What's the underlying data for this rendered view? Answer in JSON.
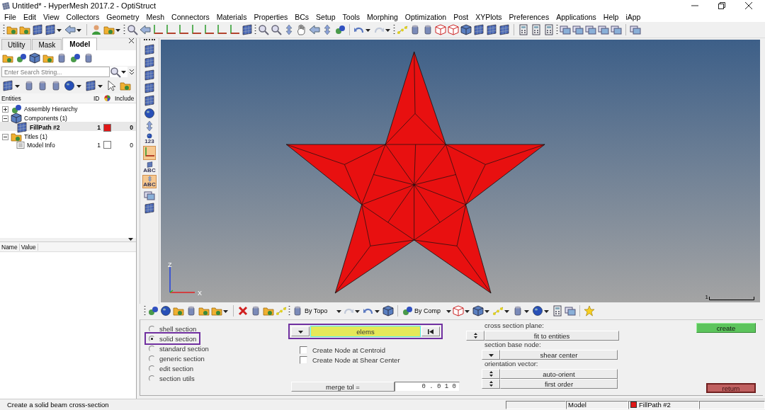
{
  "window": {
    "title": "Untitled* - HyperMesh 2017.2 - OptiStruct"
  },
  "menu": [
    "File",
    "Edit",
    "View",
    "Collectors",
    "Geometry",
    "Mesh",
    "Connectors",
    "Materials",
    "Properties",
    "BCs",
    "Setup",
    "Tools",
    "Morphing",
    "Optimization",
    "Post",
    "XYPlots",
    "Preferences",
    "Applications",
    "Help",
    "iApp"
  ],
  "browser": {
    "tabs": [
      {
        "label": "Utility",
        "selected": false
      },
      {
        "label": "Mask",
        "selected": false
      },
      {
        "label": "Model",
        "selected": true
      }
    ],
    "search": {
      "placeholder": "Enter Search String..."
    },
    "columns": [
      "Entities",
      "ID",
      "Include"
    ],
    "tree": [
      {
        "label": "Assembly Hierarchy",
        "kind": "assembly",
        "expanded": false
      },
      {
        "label": "Components (1)",
        "kind": "components",
        "expanded": true,
        "children": [
          {
            "label": "FillPath #2",
            "id": "1",
            "color": "#e01818",
            "include": "0",
            "selected": true
          }
        ]
      },
      {
        "label": "Titles (1)",
        "kind": "titles",
        "expanded": true,
        "children": [
          {
            "label": "Model Info",
            "id": "1",
            "include": "0",
            "selected": false
          }
        ]
      }
    ],
    "attribute_columns": [
      "Name",
      "Value"
    ]
  },
  "side_toolbar": {
    "labels": [
      "123",
      "ABC",
      "ABC"
    ]
  },
  "viewport": {
    "axes": {
      "z": "Z",
      "x": "X"
    },
    "scale_label": "1"
  },
  "filter_toolbar": {
    "topo_label": "By Topo",
    "comp_label": "By Comp"
  },
  "panel": {
    "sections": [
      {
        "label": "shell section",
        "selected": false,
        "highlighted": false
      },
      {
        "label": "solid section",
        "selected": true,
        "highlighted": true
      },
      {
        "label": "standard section",
        "selected": false,
        "highlighted": false
      },
      {
        "label": "generic section",
        "selected": false,
        "highlighted": false
      },
      {
        "label": "edit section",
        "selected": false,
        "highlighted": false
      },
      {
        "label": "section utils",
        "selected": false,
        "highlighted": false
      }
    ],
    "selector": {
      "value": "elems",
      "highlighted": true
    },
    "options": [
      {
        "label": "Create Node at Centroid",
        "checked": false
      },
      {
        "label": "Create Node at Shear Center",
        "checked": false
      }
    ],
    "merge_tol": {
      "label": "merge tol =",
      "value": "0 . 0 1 0"
    },
    "plane": {
      "label": "cross section plane:",
      "value": "fit to entities"
    },
    "base_node": {
      "label": "section base node:",
      "value": "shear center"
    },
    "orientation": {
      "label": "orientation vector:",
      "values": [
        "auto-orient",
        "first order"
      ]
    },
    "create": "create",
    "return": "return"
  },
  "status_bar": {
    "message": "Create a solid beam cross-section",
    "mode": "Model",
    "component": {
      "label": "FillPath #2",
      "color": "#e01818"
    }
  }
}
